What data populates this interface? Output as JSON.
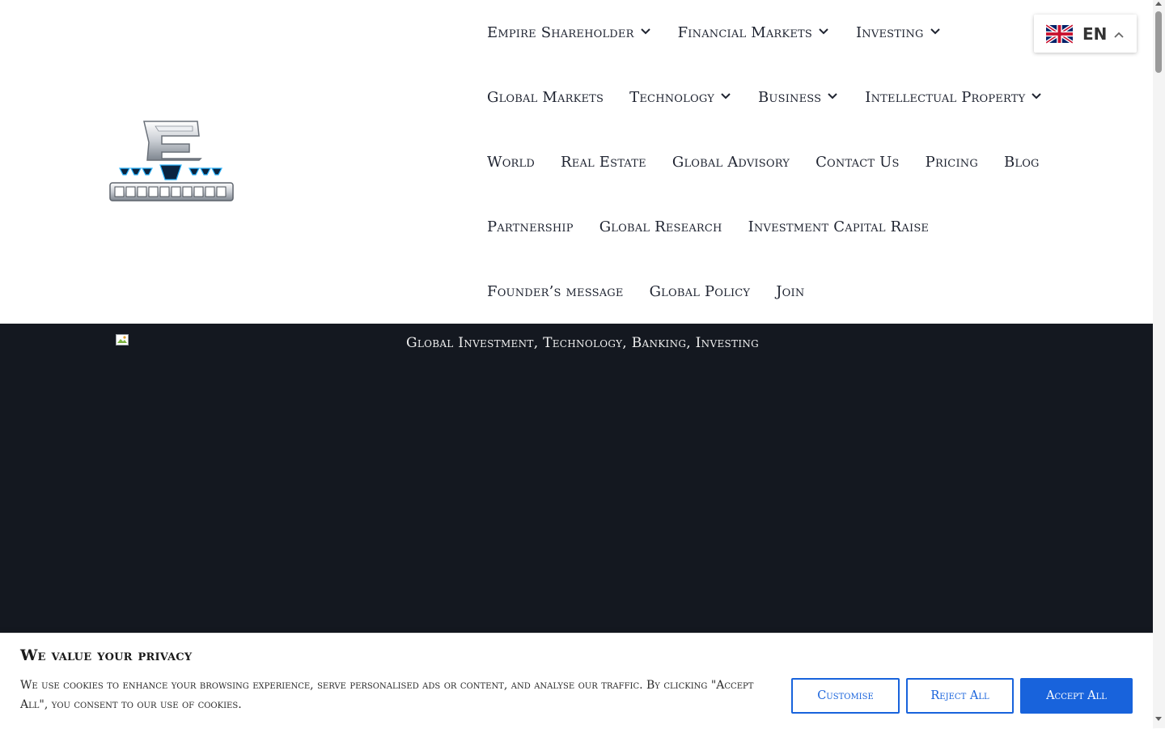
{
  "header": {
    "logo_alt": "E Shareholder",
    "nav_rows": [
      [
        {
          "label": "Empire Shareholder",
          "has_dropdown": true
        },
        {
          "label": "Financial Markets",
          "has_dropdown": true
        },
        {
          "label": "Investing",
          "has_dropdown": true
        }
      ],
      [
        {
          "label": "Global Markets",
          "has_dropdown": false
        },
        {
          "label": "Technology",
          "has_dropdown": true
        },
        {
          "label": "Business",
          "has_dropdown": true
        },
        {
          "label": "Intellectual Property",
          "has_dropdown": true
        }
      ],
      [
        {
          "label": "World",
          "has_dropdown": false
        },
        {
          "label": "Real Estate",
          "has_dropdown": false
        },
        {
          "label": "Global Advisory",
          "has_dropdown": false
        },
        {
          "label": "Contact Us",
          "has_dropdown": false
        },
        {
          "label": "Pricing",
          "has_dropdown": false
        },
        {
          "label": "Blog",
          "has_dropdown": false
        }
      ],
      [
        {
          "label": "Partnership",
          "has_dropdown": false
        },
        {
          "label": "Global Research",
          "has_dropdown": false
        },
        {
          "label": "Investment Capital Raise",
          "has_dropdown": false
        }
      ],
      [
        {
          "label": "Founder’s message",
          "has_dropdown": false
        },
        {
          "label": "Global Policy",
          "has_dropdown": false
        },
        {
          "label": "Join",
          "has_dropdown": false
        }
      ]
    ]
  },
  "language": {
    "code": "EN",
    "flag_icon": "uk-flag-icon"
  },
  "hero": {
    "image_alt": "Global Investment, Technology, Banking, Investing",
    "background_color": "#141820"
  },
  "cookie_banner": {
    "title": "We value your privacy",
    "text": "We use cookies to enhance your browsing experience, serve personalised ads or content, and analyse our traffic. By clicking \"Accept All\", you consent to our use of cookies.",
    "customise_label": "Customise",
    "reject_label": "Reject All",
    "accept_label": "Accept All",
    "accent_color": "#1863dc"
  }
}
